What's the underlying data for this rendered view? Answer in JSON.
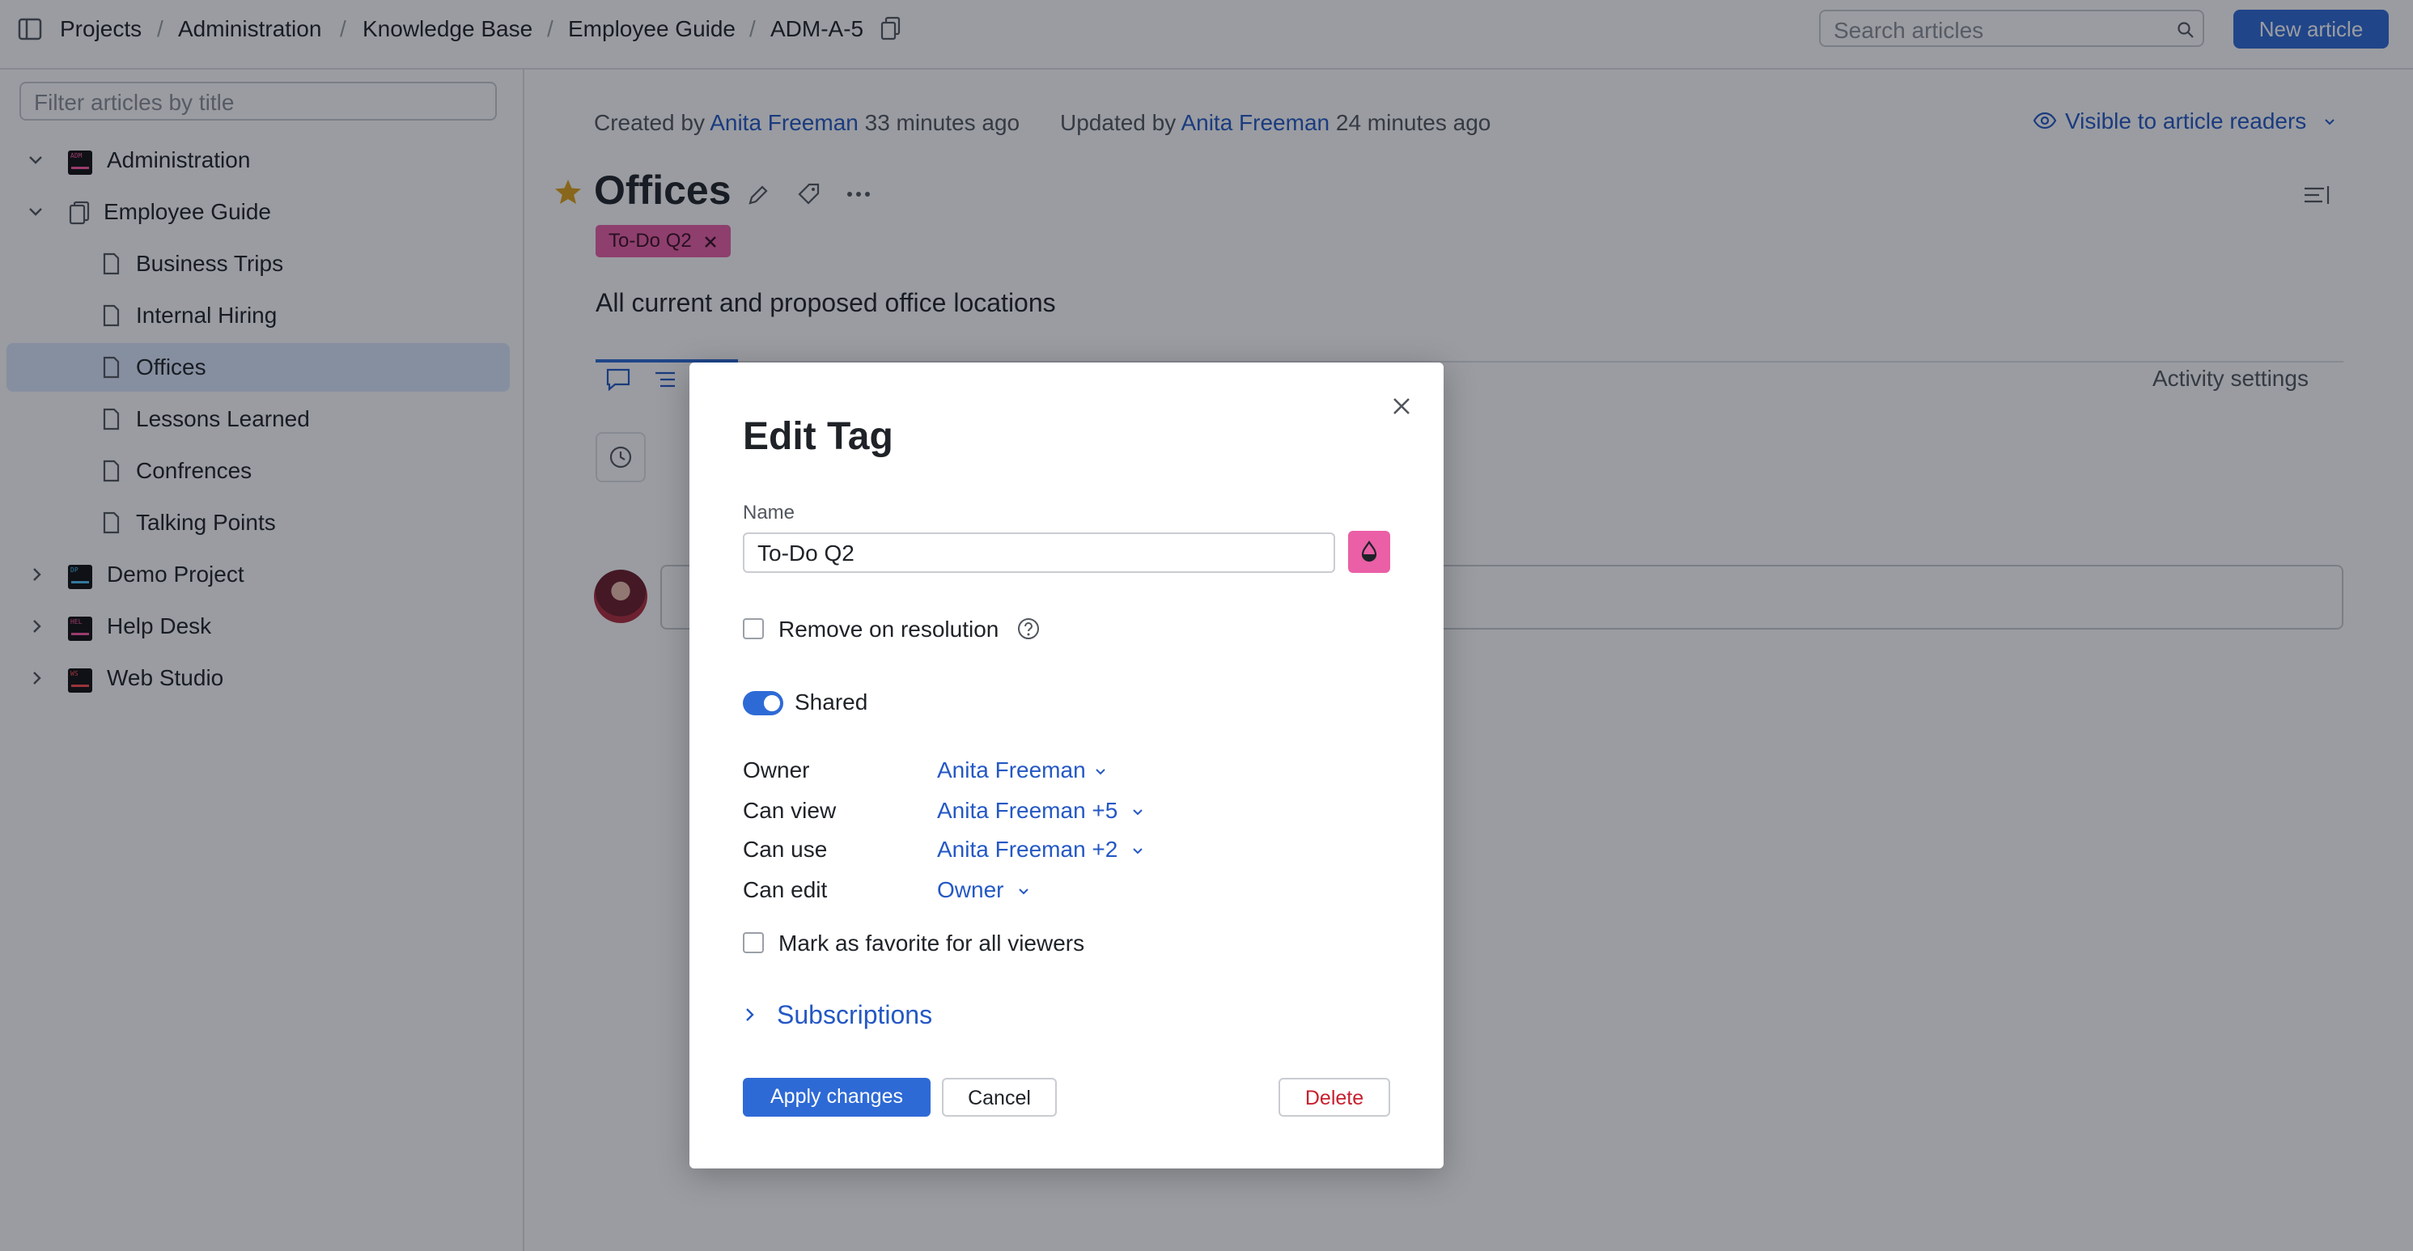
{
  "breadcrumb": {
    "items": [
      "Projects",
      "Administration",
      "Knowledge Base",
      "Employee Guide",
      "ADM-A-5"
    ],
    "separator": "/"
  },
  "search": {
    "placeholder": "Search articles"
  },
  "header": {
    "new_article_label": "New article"
  },
  "sidebar": {
    "filter_placeholder": "Filter articles by title",
    "items": [
      {
        "label": "Administration",
        "icon": "project-icon",
        "code": "ADM"
      },
      {
        "label": "Employee Guide",
        "icon": "document-icon"
      },
      {
        "label": "Business Trips",
        "icon": "page-icon"
      },
      {
        "label": "Internal Hiring",
        "icon": "page-icon"
      },
      {
        "label": "Offices",
        "icon": "page-icon",
        "selected": true
      },
      {
        "label": "Lessons Learned",
        "icon": "page-icon"
      },
      {
        "label": "Confrences",
        "icon": "page-icon"
      },
      {
        "label": "Talking Points",
        "icon": "page-icon"
      },
      {
        "label": "Demo Project",
        "icon": "project-icon",
        "code": "DP"
      },
      {
        "label": "Help Desk",
        "icon": "project-icon",
        "code": "HEL"
      },
      {
        "label": "Web Studio",
        "icon": "project-icon",
        "code": "WS"
      }
    ]
  },
  "article": {
    "created_prefix": "Created by",
    "created_by": "Anita Freeman",
    "created_ago": "33 minutes ago",
    "updated_prefix": "Updated by",
    "updated_by": "Anita Freeman",
    "updated_ago": "24 minutes ago",
    "visibility": "Visible to article readers",
    "title": "Offices",
    "tag": "To-Do Q2",
    "summary": "All current and proposed office locations",
    "activity_settings": "Activity settings"
  },
  "dialog": {
    "title": "Edit Tag",
    "name_label": "Name",
    "name_value": "To-Do Q2",
    "remove_on_resolution": "Remove on resolution",
    "shared_label": "Shared",
    "shared_on": true,
    "permissions": [
      {
        "label": "Owner",
        "value": "Anita Freeman"
      },
      {
        "label": "Can view",
        "value": "Anita Freeman +5"
      },
      {
        "label": "Can use",
        "value": "Anita Freeman +2"
      },
      {
        "label": "Can edit",
        "value": "Owner"
      }
    ],
    "favorite_label": "Mark as favorite for all viewers",
    "subscriptions_label": "Subscriptions",
    "apply_label": "Apply changes",
    "cancel_label": "Cancel",
    "delete_label": "Delete"
  },
  "colors": {
    "accent": "#2e6ad6",
    "link": "#2458c4",
    "tag": "#ea5fa6",
    "delete": "#c8202f",
    "star": "#e0a21b"
  }
}
